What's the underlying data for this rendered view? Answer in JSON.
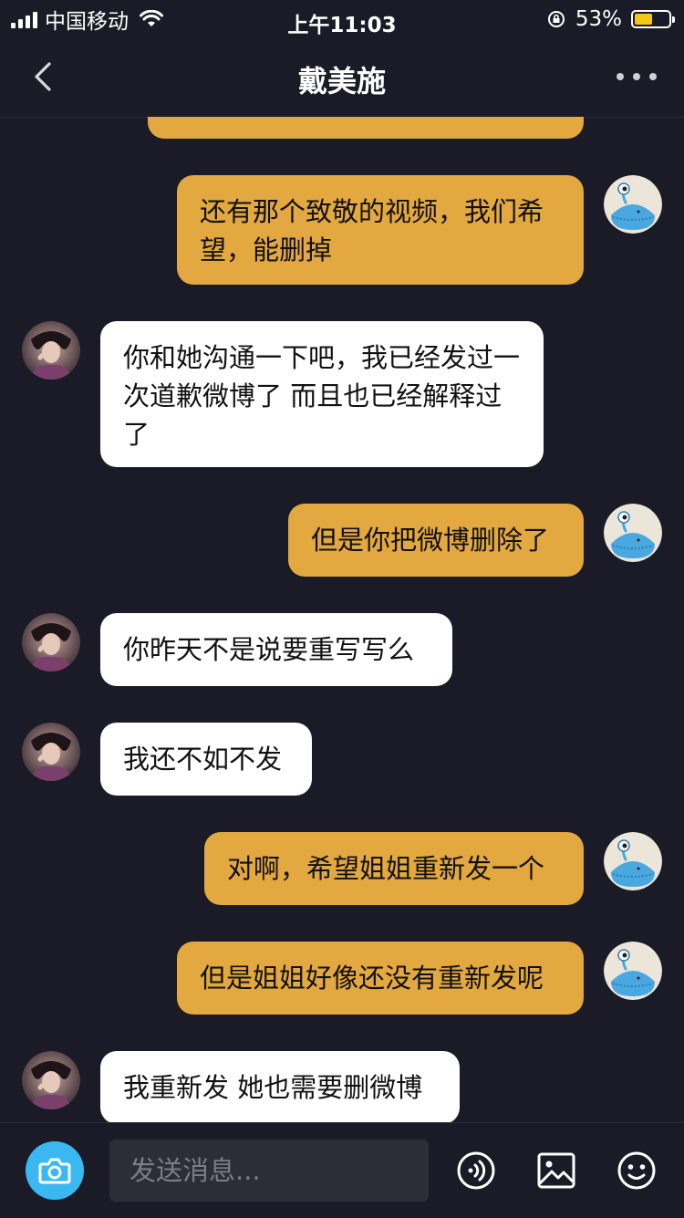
{
  "status_bar": {
    "carrier": "中国移动",
    "time": "上午11:03",
    "battery_text": "53%",
    "battery_level": 0.53,
    "battery_color": "#f5c518"
  },
  "nav": {
    "title": "戴美施",
    "back_icon": "chevron-left-icon",
    "more_icon": "more-dots-icon"
  },
  "colors": {
    "background": "#1a1b26",
    "my_bubble": "#e3a83f",
    "their_bubble": "#ffffff",
    "camera_button": "#3bb8f2"
  },
  "messages": [
    {
      "sender": "me",
      "text": ""
    },
    {
      "sender": "me",
      "text": "还有那个致敬的视频，我们希望，能删掉"
    },
    {
      "sender": "them",
      "text": "你和她沟通一下吧，我已经发过一次道歉微博了 而且也已经解释过了"
    },
    {
      "sender": "me",
      "text": "但是你把微博删除了"
    },
    {
      "sender": "them",
      "text": "你昨天不是说要重写写么"
    },
    {
      "sender": "them",
      "text": "我还不如不发"
    },
    {
      "sender": "me",
      "text": "对啊，希望姐姐重新发一个"
    },
    {
      "sender": "me",
      "text": "但是姐姐好像还没有重新发呢"
    },
    {
      "sender": "them",
      "text": "我重新发 她也需要删微博"
    }
  ],
  "input_bar": {
    "placeholder": "发送消息...",
    "camera_icon": "camera-icon",
    "voice_icon": "voice-icon",
    "image_icon": "image-icon",
    "emoji_icon": "emoji-icon"
  }
}
